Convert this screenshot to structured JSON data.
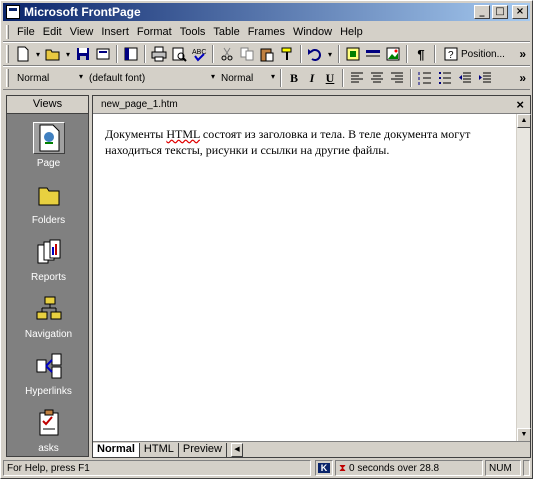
{
  "title": "Microsoft FrontPage",
  "window_controls": {
    "minimize": "_",
    "maximize": "□",
    "close": "×"
  },
  "menu": [
    "File",
    "Edit",
    "View",
    "Insert",
    "Format",
    "Tools",
    "Table",
    "Frames",
    "Window",
    "Help"
  ],
  "toolbar": {
    "position_label": "Position...",
    "chevron": "»"
  },
  "format_bar": {
    "style": "Normal",
    "font": "(default font)",
    "size": "Normal",
    "bold": "B",
    "italic": "I",
    "underline": "U",
    "chevron": "»"
  },
  "views": {
    "header": "Views",
    "items": [
      {
        "label": "Page",
        "icon": "page-view-icon",
        "selected": true
      },
      {
        "label": "Folders",
        "icon": "folder-icon"
      },
      {
        "label": "Reports",
        "icon": "reports-icon"
      },
      {
        "label": "Navigation",
        "icon": "navigation-icon"
      },
      {
        "label": "Hyperlinks",
        "icon": "hyperlinks-icon"
      },
      {
        "label": "asks",
        "icon": "tasks-icon"
      }
    ]
  },
  "document": {
    "tab_title": "new_page_1.htm",
    "close": "×",
    "text_before": "Документы ",
    "text_spell": "HTML",
    "text_after": " состоят из заголовка и тела. В теле документа могут находиться тексты, рисунки и ссылки на другие файлы."
  },
  "bottom_tabs": [
    "Normal",
    "HTML",
    "Preview"
  ],
  "status": {
    "help": "For Help, press F1",
    "k": "K",
    "time": "0 seconds over 28.8",
    "num": "NUM"
  },
  "colors": {
    "title_start": "#0a246a",
    "title_end": "#a6caf0",
    "chrome": "#d4d0c8",
    "views_bg": "#808080"
  }
}
